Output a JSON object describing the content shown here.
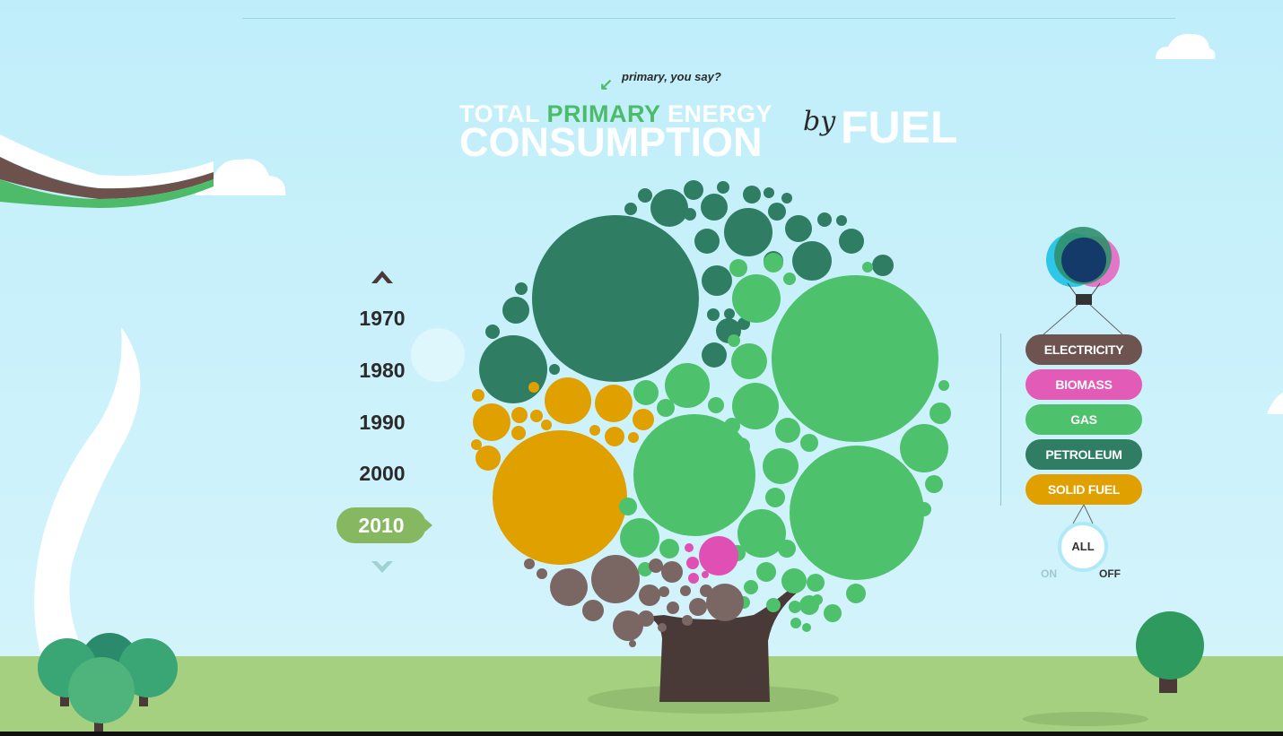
{
  "title": {
    "hint": "primary, you say?",
    "line1_a": "TOTAL ",
    "line1_b": "PRIMARY",
    "line1_c": " ENERGY",
    "line2": "CONSUMPTION",
    "by": "by",
    "fuel": "FUEL"
  },
  "decades": {
    "items": [
      "1970",
      "1980",
      "1990",
      "2000"
    ],
    "selected": "2010"
  },
  "legend": {
    "items": [
      {
        "label": "ELECTRICITY",
        "color": "#6e5450"
      },
      {
        "label": "BIOMASS",
        "color": "#e15bb7"
      },
      {
        "label": "GAS",
        "color": "#4dc16c"
      },
      {
        "label": "PETROLEUM",
        "color": "#2f7d63"
      },
      {
        "label": "SOLID FUEL",
        "color": "#e0a000"
      }
    ],
    "all_label": "ALL",
    "on_label": "ON",
    "off_label": "OFF"
  },
  "colors": {
    "petroleum": "#2f7d63",
    "gas": "#4dc16c",
    "solid_fuel": "#e0a000",
    "electricity": "#7a6662",
    "biomass": "#e04fb3",
    "trunk": "#4a3a37",
    "selected_year_bg": "#86b861",
    "ground": "#a4d07f"
  },
  "icons": {
    "up": "chevron-up-icon",
    "down": "chevron-down-icon",
    "balloon": "hot-air-balloon-icon"
  }
}
